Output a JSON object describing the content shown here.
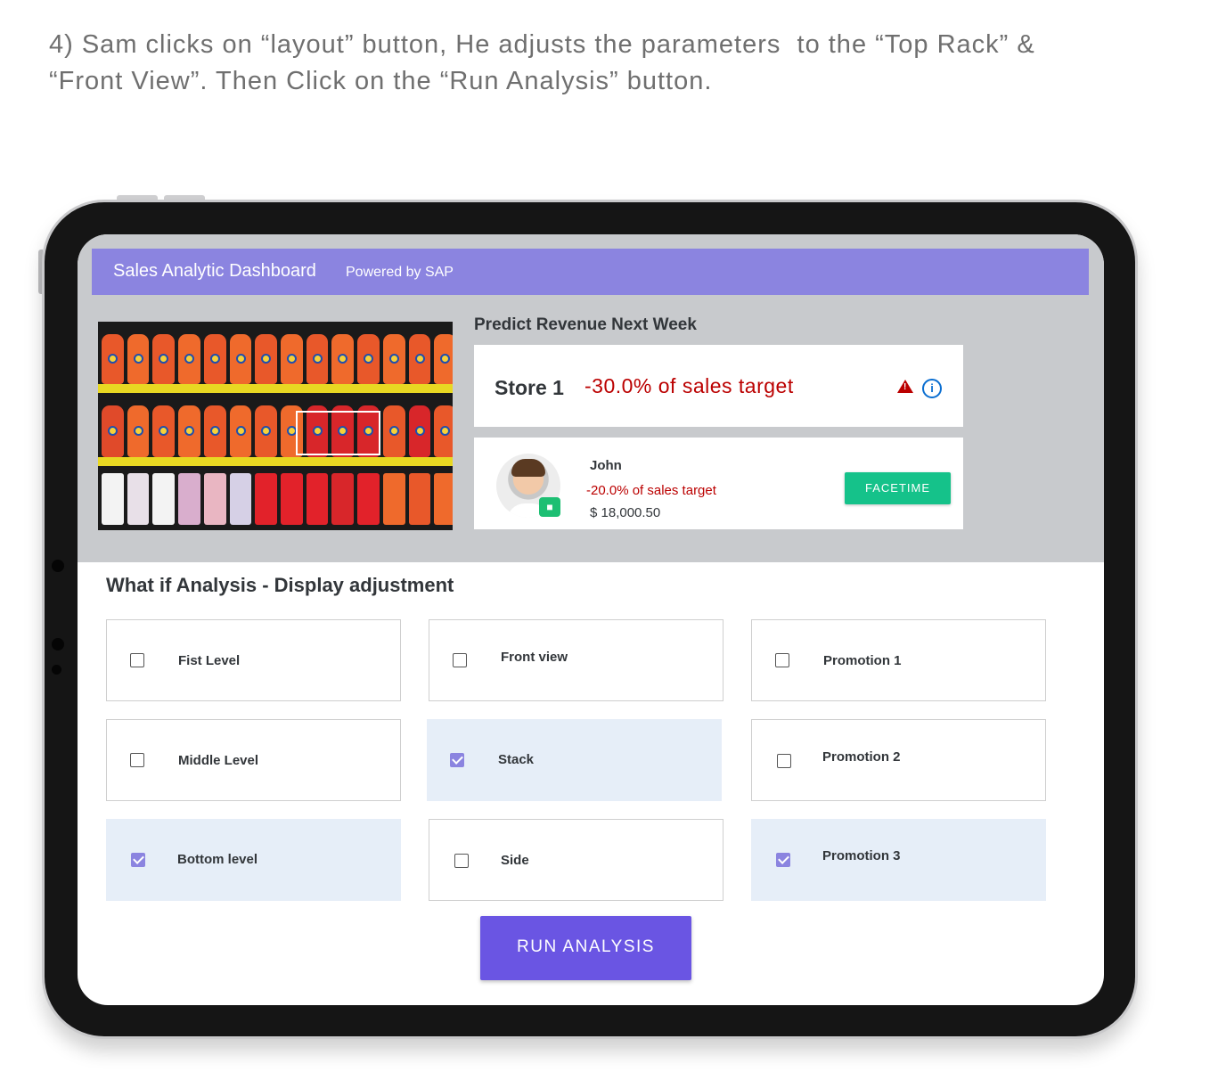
{
  "caption": {
    "line1": "4) Sam clicks on “layout” button, He adjusts the parameters  to the “Top Rack” &",
    "line2": "“Front View”. Then Click on the “Run Analysis” button."
  },
  "app": {
    "title": "Sales Analytic Dashboard",
    "subtitle": "Powered by SAP",
    "accent_color": "#8b84e0"
  },
  "predict": {
    "heading": "Predict Revenue Next Week",
    "store_name": "Store 1",
    "store_value": "-30.0% of sales target",
    "warning_icon": "warning-triangle-icon",
    "info_icon": "info-circle-icon"
  },
  "contact": {
    "name": "John",
    "target": "-20.0% of sales target",
    "amount": "$ 18,000.50",
    "video_icon": "video-camera-icon",
    "facetime_label": "FACETIME"
  },
  "analysis": {
    "heading": "What if Analysis - Display adjustment",
    "options": [
      {
        "label": "Fist Level",
        "checked": false
      },
      {
        "label": "Front view",
        "checked": false
      },
      {
        "label": "Promotion 1",
        "checked": false
      },
      {
        "label": "Middle Level",
        "checked": false
      },
      {
        "label": "Stack",
        "checked": true
      },
      {
        "label": "Promotion 2",
        "checked": false
      },
      {
        "label": "Bottom level",
        "checked": true
      },
      {
        "label": "Side",
        "checked": false
      },
      {
        "label": "Promotion 3",
        "checked": true
      }
    ],
    "run_label": "RUN ANALYSIS"
  }
}
